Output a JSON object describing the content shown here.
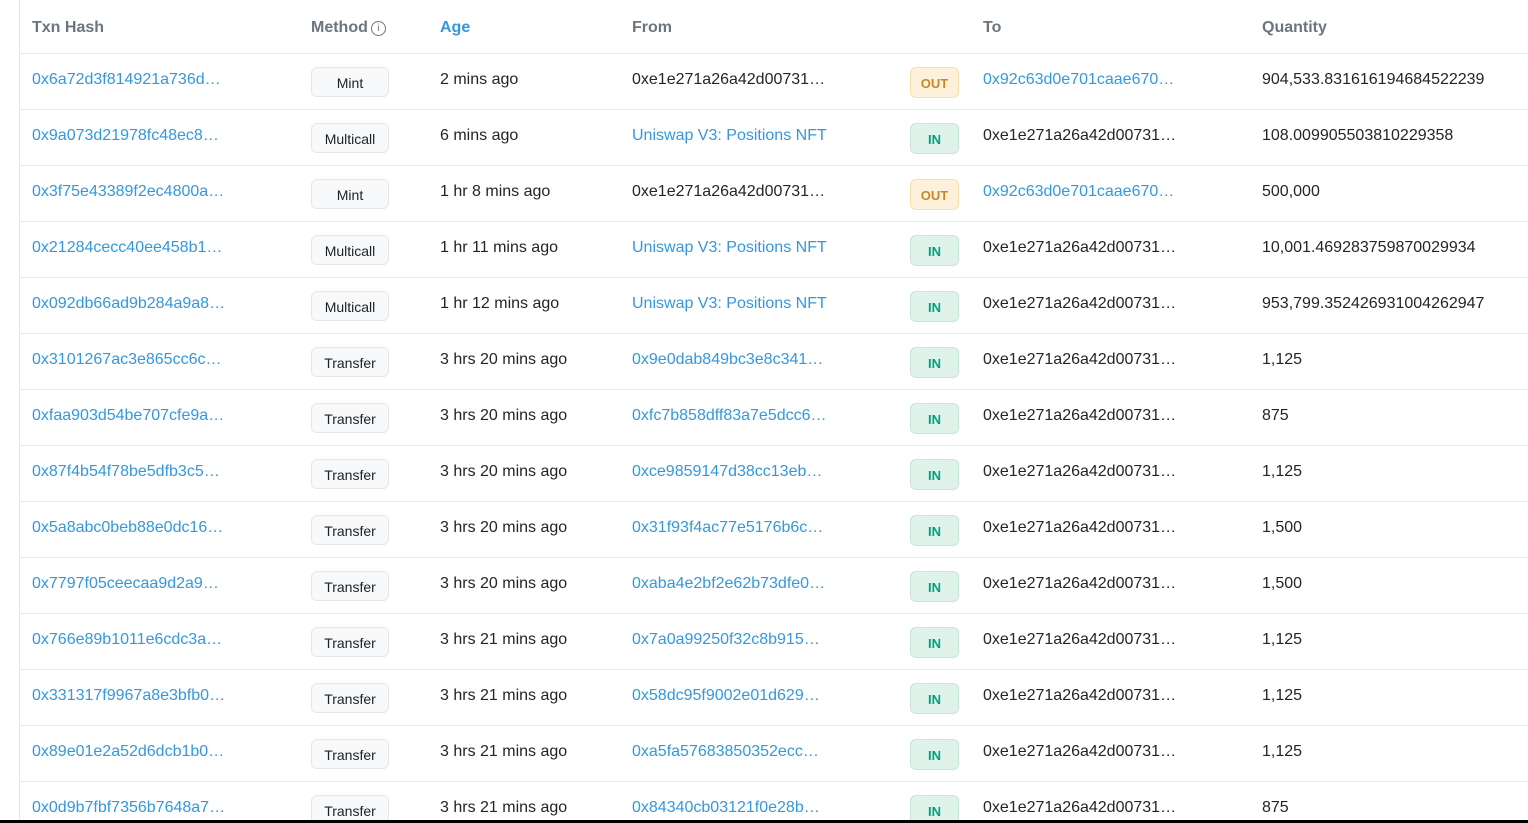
{
  "headers": {
    "txn_hash": "Txn Hash",
    "method": "Method",
    "method_info_icon": "ⓘ",
    "age": "Age",
    "from": "From",
    "to": "To",
    "quantity": "Quantity"
  },
  "colors": {
    "link": "#3498db",
    "out_badge": "#c4882a",
    "in_badge": "#00a186"
  },
  "rows": [
    {
      "hash": "0x6a72d3f814921a736d…",
      "method": "Mint",
      "age": "2 mins ago",
      "from": "0xe1e271a26a42d00731…",
      "from_link": false,
      "dir": "OUT",
      "to": "0x92c63d0e701caae670…",
      "to_link": true,
      "quantity": "904,533.831616194684522239"
    },
    {
      "hash": "0x9a073d21978fc48ec8…",
      "method": "Multicall",
      "age": "6 mins ago",
      "from": "Uniswap V3: Positions NFT",
      "from_link": true,
      "dir": "IN",
      "to": "0xe1e271a26a42d00731…",
      "to_link": false,
      "quantity": "108.009905503810229358"
    },
    {
      "hash": "0x3f75e43389f2ec4800a…",
      "method": "Mint",
      "age": "1 hr 8 mins ago",
      "from": "0xe1e271a26a42d00731…",
      "from_link": false,
      "dir": "OUT",
      "to": "0x92c63d0e701caae670…",
      "to_link": true,
      "quantity": "500,000"
    },
    {
      "hash": "0x21284cecc40ee458b1…",
      "method": "Multicall",
      "age": "1 hr 11 mins ago",
      "from": "Uniswap V3: Positions NFT",
      "from_link": true,
      "dir": "IN",
      "to": "0xe1e271a26a42d00731…",
      "to_link": false,
      "quantity": "10,001.469283759870029934"
    },
    {
      "hash": "0x092db66ad9b284a9a8…",
      "method": "Multicall",
      "age": "1 hr 12 mins ago",
      "from": "Uniswap V3: Positions NFT",
      "from_link": true,
      "dir": "IN",
      "to": "0xe1e271a26a42d00731…",
      "to_link": false,
      "quantity": "953,799.352426931004262947"
    },
    {
      "hash": "0x3101267ac3e865cc6c…",
      "method": "Transfer",
      "age": "3 hrs 20 mins ago",
      "from": "0x9e0dab849bc3e8c341…",
      "from_link": true,
      "dir": "IN",
      "to": "0xe1e271a26a42d00731…",
      "to_link": false,
      "quantity": "1,125"
    },
    {
      "hash": "0xfaa903d54be707cfe9a…",
      "method": "Transfer",
      "age": "3 hrs 20 mins ago",
      "from": "0xfc7b858dff83a7e5dcc6…",
      "from_link": true,
      "dir": "IN",
      "to": "0xe1e271a26a42d00731…",
      "to_link": false,
      "quantity": "875"
    },
    {
      "hash": "0x87f4b54f78be5dfb3c5…",
      "method": "Transfer",
      "age": "3 hrs 20 mins ago",
      "from": "0xce9859147d38cc13eb…",
      "from_link": true,
      "dir": "IN",
      "to": "0xe1e271a26a42d00731…",
      "to_link": false,
      "quantity": "1,125"
    },
    {
      "hash": "0x5a8abc0beb88e0dc16…",
      "method": "Transfer",
      "age": "3 hrs 20 mins ago",
      "from": "0x31f93f4ac77e5176b6c…",
      "from_link": true,
      "dir": "IN",
      "to": "0xe1e271a26a42d00731…",
      "to_link": false,
      "quantity": "1,500"
    },
    {
      "hash": "0x7797f05ceecaa9d2a9…",
      "method": "Transfer",
      "age": "3 hrs 20 mins ago",
      "from": "0xaba4e2bf2e62b73dfe0…",
      "from_link": true,
      "dir": "IN",
      "to": "0xe1e271a26a42d00731…",
      "to_link": false,
      "quantity": "1,500"
    },
    {
      "hash": "0x766e89b1011e6cdc3a…",
      "method": "Transfer",
      "age": "3 hrs 21 mins ago",
      "from": "0x7a0a99250f32c8b915…",
      "from_link": true,
      "dir": "IN",
      "to": "0xe1e271a26a42d00731…",
      "to_link": false,
      "quantity": "1,125"
    },
    {
      "hash": "0x331317f9967a8e3bfb0…",
      "method": "Transfer",
      "age": "3 hrs 21 mins ago",
      "from": "0x58dc95f9002e01d629…",
      "from_link": true,
      "dir": "IN",
      "to": "0xe1e271a26a42d00731…",
      "to_link": false,
      "quantity": "1,125"
    },
    {
      "hash": "0x89e01e2a52d6dcb1b0…",
      "method": "Transfer",
      "age": "3 hrs 21 mins ago",
      "from": "0xa5fa57683850352ecc…",
      "from_link": true,
      "dir": "IN",
      "to": "0xe1e271a26a42d00731…",
      "to_link": false,
      "quantity": "1,125"
    },
    {
      "hash": "0x0d9b7fbf7356b7648a7…",
      "method": "Transfer",
      "age": "3 hrs 21 mins ago",
      "from": "0x84340cb03121f0e28b…",
      "from_link": true,
      "dir": "IN",
      "to": "0xe1e271a26a42d00731…",
      "to_link": false,
      "quantity": "875"
    }
  ]
}
